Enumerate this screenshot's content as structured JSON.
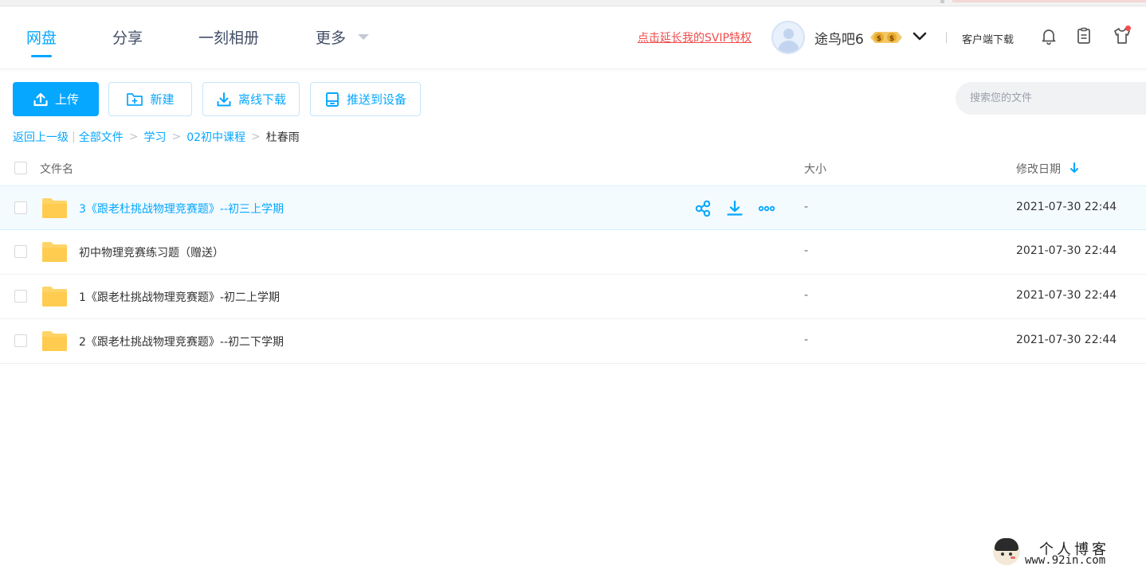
{
  "nav": {
    "tabs": [
      {
        "label": "网盘",
        "active": true
      },
      {
        "label": "分享",
        "active": false
      },
      {
        "label": "一刻相册",
        "active": false
      },
      {
        "label": "更多",
        "active": false
      }
    ]
  },
  "header": {
    "svip_link": "点击延长我的SVIP特权",
    "username": "途鸟吧6",
    "client_download": "客户端下载",
    "icons": [
      "bell-icon",
      "clipboard-icon",
      "tshirt-icon"
    ]
  },
  "toolbar": {
    "upload": "上传",
    "new": "新建",
    "offline_download": "离线下载",
    "push_device": "推送到设备"
  },
  "search": {
    "placeholder": "搜索您的文件"
  },
  "breadcrumb": {
    "back": "返回上一级",
    "items": [
      "全部文件",
      "学习",
      "02初中课程"
    ],
    "current": "杜春雨"
  },
  "table": {
    "columns": {
      "name": "文件名",
      "size": "大小",
      "date": "修改日期"
    },
    "rows": [
      {
        "name": "3《跟老杜挑战物理竞赛题》--初三上学期",
        "size": "-",
        "date": "2021-07-30 22:44"
      },
      {
        "name": "初中物理竞赛练习题（赠送）",
        "size": "-",
        "date": "2021-07-30 22:44"
      },
      {
        "name": "1《跟老杜挑战物理竞赛题》-初二上学期",
        "size": "-",
        "date": "2021-07-30 22:44"
      },
      {
        "name": "2《跟老杜挑战物理竞赛题》--初二下学期",
        "size": "-",
        "date": "2021-07-30 22:44"
      }
    ]
  },
  "watermark": {
    "title": "个人博客",
    "url": "www.92in.com"
  },
  "colors": {
    "accent": "#06a7ff",
    "svip": "#f14d4d",
    "folder": "#ffd467"
  }
}
